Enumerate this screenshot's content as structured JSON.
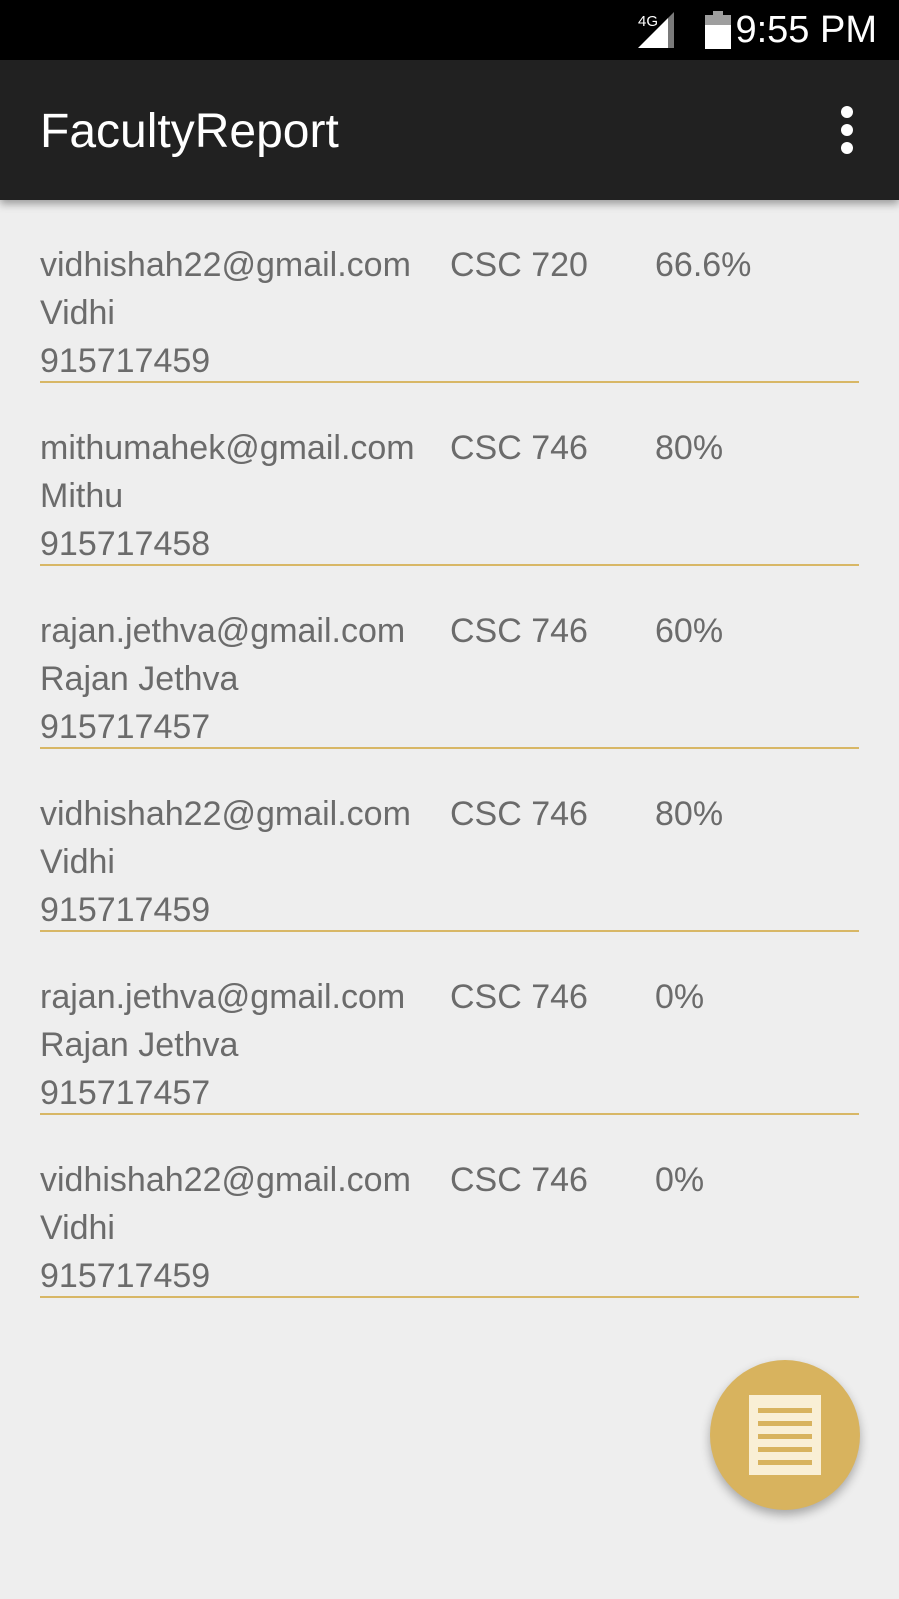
{
  "status_bar": {
    "network": "4G",
    "time": "9:55 PM"
  },
  "app_bar": {
    "title": "FacultyReport",
    "menu_icon": "more-vert-icon"
  },
  "reports": [
    {
      "email": "vidhishah22@gmail.com",
      "name": "Vidhi",
      "phone": "915717459",
      "course": "CSC 720",
      "score": "66.6%"
    },
    {
      "email": "mithumahek@gmail.com",
      "name": "Mithu",
      "phone": "915717458",
      "course": "CSC 746",
      "score": "80%"
    },
    {
      "email": "rajan.jethva@gmail.com",
      "name": "Rajan Jethva",
      "phone": "915717457",
      "course": "CSC 746",
      "score": "60%"
    },
    {
      "email": "vidhishah22@gmail.com",
      "name": "Vidhi",
      "phone": "915717459",
      "course": "CSC 746",
      "score": "80%"
    },
    {
      "email": "rajan.jethva@gmail.com",
      "name": "Rajan Jethva",
      "phone": "915717457",
      "course": "CSC 746",
      "score": "0%"
    },
    {
      "email": "vidhishah22@gmail.com",
      "name": "Vidhi",
      "phone": "915717459",
      "course": "CSC 746",
      "score": "0%"
    }
  ],
  "fab": {
    "icon": "report-document-icon"
  },
  "colors": {
    "accent": "#d8b35e",
    "divider": "#d8b766",
    "app_bar": "#212121",
    "background": "#eeeeee",
    "text": "#6b6b6b"
  }
}
